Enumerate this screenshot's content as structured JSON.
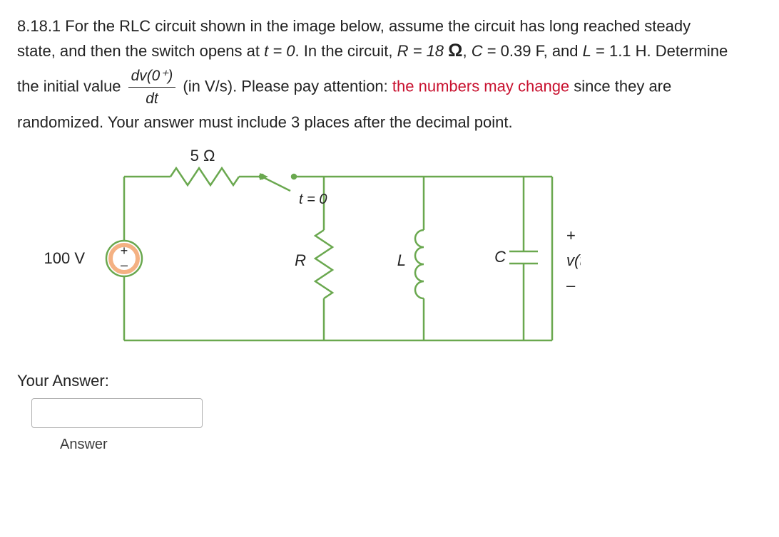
{
  "problem": {
    "number": "8.18.1",
    "lead1": "For the RLC circuit shown in the image below, assume the circuit has long reached steady state, and then the switch opens at ",
    "t_eq": "t = 0",
    "lead2": ". In the circuit, ",
    "R_expr_prefix": "R = 18 ",
    "R_unit": "Ω",
    "comma1": ", ",
    "C_letter": "C",
    "lead3": " = 0.39 F, and ",
    "L_letter": "L",
    "L_expr": " = 1.1 H. Determine the initial value ",
    "frac_num": "dv(0⁺)",
    "frac_den": "dt",
    "lead4": " (in V/s). Please pay attention: ",
    "warn": "the numbers may change",
    "lead5": " since they are randomized. Your answer must include 3 places after the decimal point."
  },
  "circuit": {
    "v_source": "100 V",
    "r_series": "5 Ω",
    "t_switch": "t = 0",
    "R_label": "R",
    "L_label": "L",
    "C_label": "C",
    "v_plus": "+",
    "v_out": "v(t)",
    "v_minus": "–"
  },
  "answer": {
    "label": "Your Answer:",
    "hint": "Answer"
  }
}
